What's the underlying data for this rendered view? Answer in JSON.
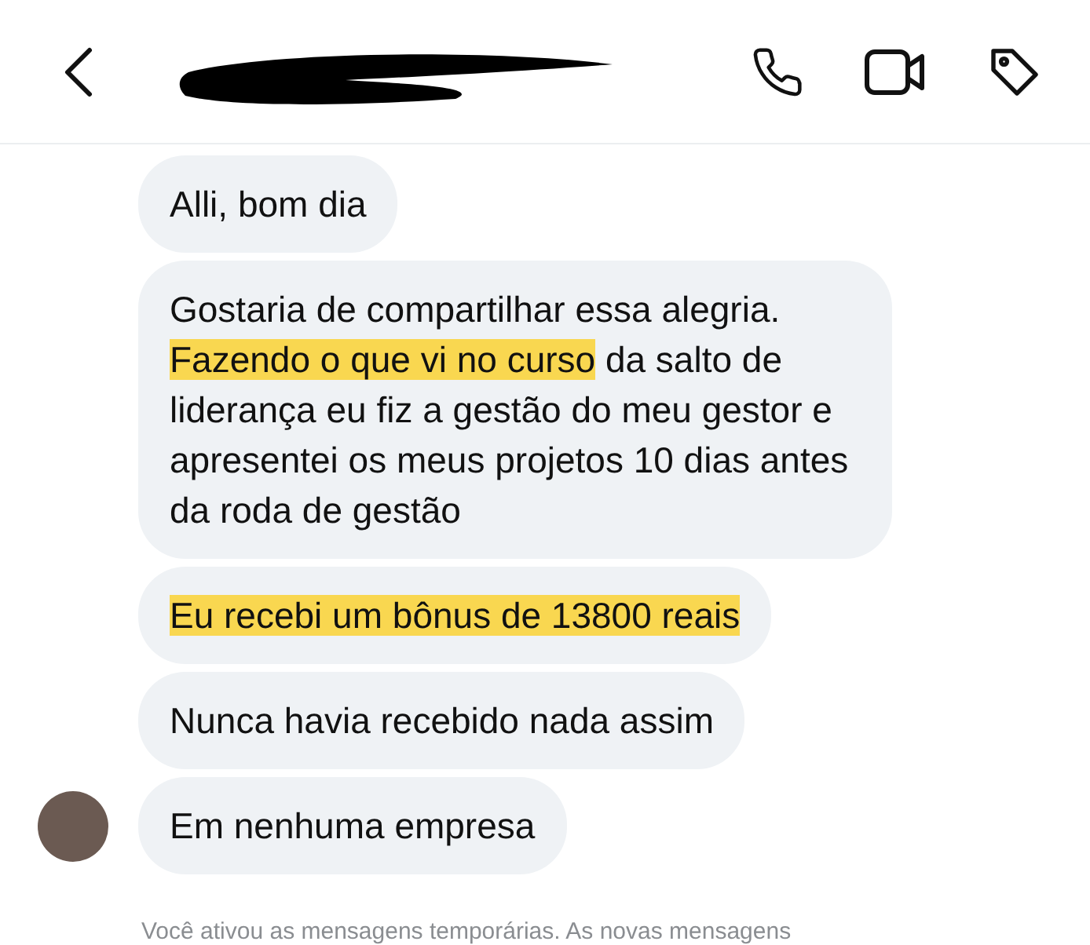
{
  "header": {
    "contact_redacted": true
  },
  "messages": [
    {
      "segments": [
        {
          "text": "Alli, bom dia",
          "highlighted": false
        }
      ],
      "avatar": false
    },
    {
      "segments": [
        {
          "text": "Gostaria de compartilhar essa alegria. ",
          "highlighted": false
        },
        {
          "text": "Fazendo o que vi no curso",
          "highlighted": true
        },
        {
          "text": " da salto de liderança eu fiz a gestão do meu gestor e apresentei os meus projetos 10 dias antes da roda de gestão",
          "highlighted": false
        }
      ],
      "avatar": false
    },
    {
      "segments": [
        {
          "text": "Eu recebi um bônus de 13800 reais",
          "highlighted": true
        }
      ],
      "avatar": false
    },
    {
      "segments": [
        {
          "text": "Nunca havia recebido nada assim",
          "highlighted": false
        }
      ],
      "avatar": false
    },
    {
      "segments": [
        {
          "text": "Em nenhuma empresa",
          "highlighted": false
        }
      ],
      "avatar": true
    }
  ],
  "notice": "Você ativou as mensagens temporárias. As novas mensagens"
}
